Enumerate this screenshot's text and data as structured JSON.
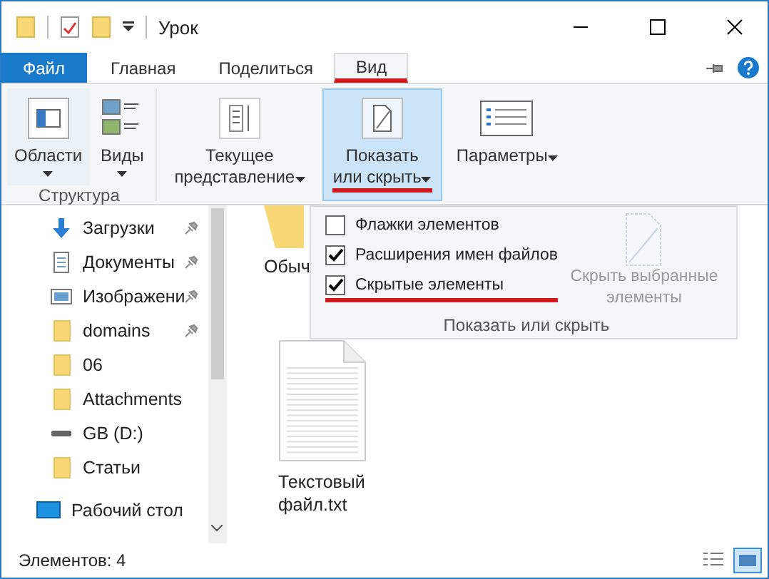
{
  "window": {
    "title": "Урок"
  },
  "tabs": [
    {
      "label": "Файл",
      "kind": "file",
      "selected": false,
      "underlined": false
    },
    {
      "label": "Главная",
      "kind": "tab",
      "selected": false,
      "underlined": false
    },
    {
      "label": "Поделиться",
      "kind": "tab",
      "selected": false,
      "underlined": false
    },
    {
      "label": "Вид",
      "kind": "tab",
      "selected": true,
      "underlined": true
    }
  ],
  "ribbon": {
    "structure_group": {
      "label": "Структура",
      "buttons": [
        {
          "label": "Области"
        },
        {
          "label": "Виды"
        }
      ]
    },
    "buttons": [
      {
        "label": "Текущее представление",
        "selected": false,
        "underlined": false
      },
      {
        "label": "Показать или скрыть",
        "selected": true,
        "underlined": true
      },
      {
        "label": "Параметры",
        "selected": false,
        "underlined": false
      }
    ]
  },
  "dropdown": {
    "checkboxes": [
      {
        "label": "Флажки элементов",
        "checked": false,
        "underlined": false
      },
      {
        "label": "Расширения имен файлов",
        "checked": true,
        "underlined": false
      },
      {
        "label": "Скрытые элементы",
        "checked": true,
        "underlined": true
      }
    ],
    "hide_button": {
      "label": "Скрыть выбранные элементы",
      "disabled": true
    },
    "group_label": "Показать или скрыть"
  },
  "sidebar": {
    "items": [
      {
        "label": "Загрузки",
        "kind": "download",
        "pinned": true
      },
      {
        "label": "Документы",
        "kind": "document",
        "pinned": true
      },
      {
        "label": "Изображени",
        "kind": "image",
        "pinned": true
      },
      {
        "label": "domains",
        "kind": "folder",
        "pinned": true
      },
      {
        "label": "06",
        "kind": "folder",
        "pinned": false
      },
      {
        "label": "Attachments",
        "kind": "folder",
        "pinned": false
      },
      {
        "label": "GB (D:)",
        "kind": "drive",
        "pinned": false
      },
      {
        "label": "Статьи",
        "kind": "folder",
        "pinned": false
      },
      {
        "label": "Рабочий стол",
        "kind": "desktop",
        "pinned": false
      }
    ]
  },
  "files": [
    {
      "name": "Обыч",
      "kind": "folder"
    },
    {
      "name": "Текстовый файл.txt",
      "kind": "text"
    }
  ],
  "status_bar": {
    "text": "Элементов: 4"
  }
}
